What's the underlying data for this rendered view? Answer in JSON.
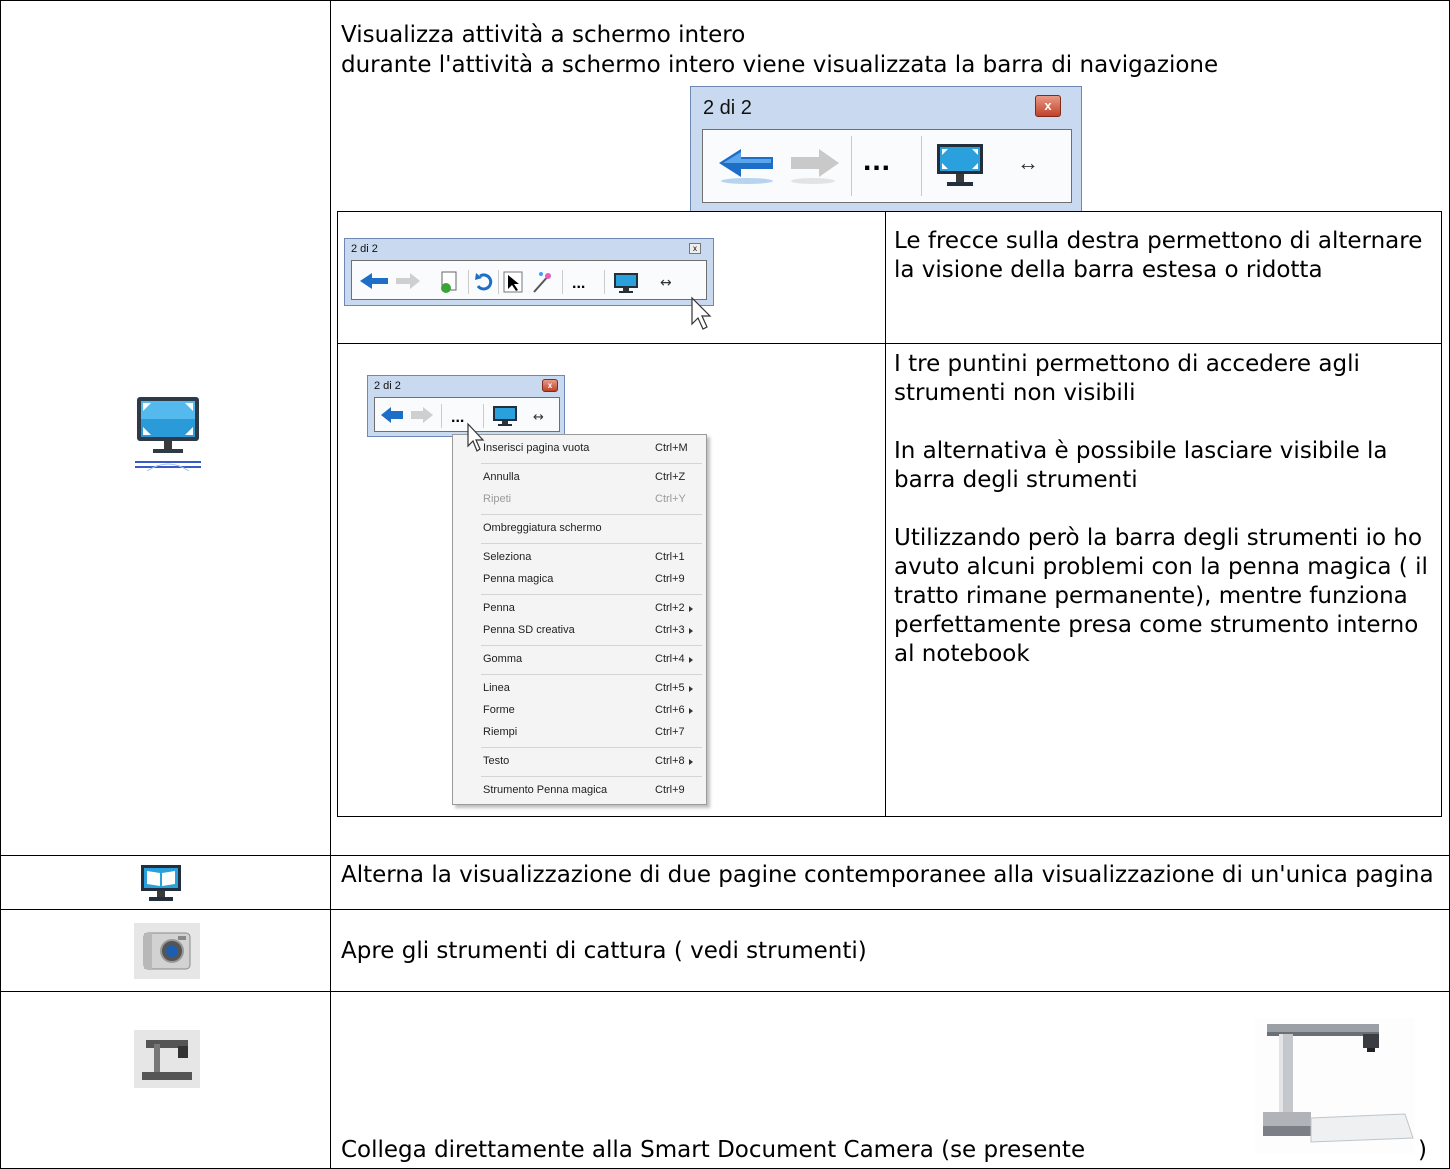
{
  "row1": {
    "title": "Visualizza attività a schermo intero",
    "subtitle": "durante l'attività a schermo intero viene visualizzata la barra di navigazione",
    "toolbar_page": "2 di 2",
    "toolbar_close": "x",
    "toolbar_more": "...",
    "toolbar_toggle": "↔",
    "nested": {
      "row_a_text": "Le frecce sulla destra permettono di alternare la visione della barra estesa o ridotta",
      "row_b_lines": [
        "I tre puntini permettono di accedere agli strumenti non visibili",
        "In alternativa è possibile lasciare visibile la barra degli strumenti",
        "Utilizzando però la barra degli strumenti io ho avuto alcuni problemi con la penna magica ( il tratto rimane permanente), mentre funziona perfettamente presa come strumento interno al notebook"
      ]
    },
    "menu": [
      {
        "label": "Inserisci pagina vuota",
        "shortcut": "Ctrl+M"
      },
      {
        "label": "Annulla",
        "shortcut": "Ctrl+Z"
      },
      {
        "label": "Ripeti",
        "shortcut": "Ctrl+Y"
      },
      {
        "label": "Ombreggiatura schermo",
        "shortcut": ""
      },
      {
        "label": "Seleziona",
        "shortcut": "Ctrl+1"
      },
      {
        "label": "Penna magica",
        "shortcut": "Ctrl+9"
      },
      {
        "label": "Penna",
        "shortcut": "Ctrl+2"
      },
      {
        "label": "Penna SD creativa",
        "shortcut": "Ctrl+3"
      },
      {
        "label": "Gomma",
        "shortcut": "Ctrl+4"
      },
      {
        "label": "Linea",
        "shortcut": "Ctrl+5"
      },
      {
        "label": "Forme",
        "shortcut": "Ctrl+6"
      },
      {
        "label": "Riempi",
        "shortcut": "Ctrl+7"
      },
      {
        "label": "Testo",
        "shortcut": "Ctrl+8"
      },
      {
        "label": "Strumento Penna magica",
        "shortcut": "Ctrl+9"
      }
    ]
  },
  "row2": {
    "text": "Alterna la visualizzazione di due pagine contemporanee alla visualizzazione di un'unica pagina"
  },
  "row3": {
    "text": "Apre gli strumenti di cattura ( vedi strumenti)"
  },
  "row4": {
    "text": "Collega direttamente alla Smart Document Camera (se presente",
    "close_paren": ")"
  }
}
